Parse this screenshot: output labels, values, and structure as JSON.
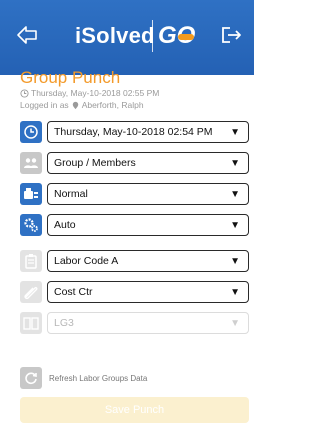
{
  "header": {
    "brand": "iSolved",
    "brand_go": "GO",
    "back_icon": "back-arrow-icon",
    "logout_icon": "logout-icon",
    "bg_color": "#2f71c4",
    "accent": "#f39a1c"
  },
  "page": {
    "title": "Group Punch",
    "current_time": "Thursday, May-10-2018 02:55 PM",
    "logged_in_prefix": "Logged in as",
    "user_name": "Aberforth, Ralph"
  },
  "fields": [
    {
      "icon": "clock-icon",
      "value": "Thursday, May-10-2018 02:54 PM",
      "enabled": true
    },
    {
      "icon": "group-members-icon",
      "value": "Group / Members",
      "enabled": true
    },
    {
      "icon": "punch-type-icon",
      "value": "Normal",
      "enabled": true
    },
    {
      "icon": "gears-icon",
      "value": "Auto",
      "enabled": true
    },
    {
      "icon": "labor-code-icon",
      "value": "Labor Code A",
      "enabled": true
    },
    {
      "icon": "cost-center-icon",
      "value": "Cost Ctr",
      "enabled": true
    },
    {
      "icon": "labor-group-icon",
      "value": "LG3",
      "enabled": false
    }
  ],
  "actions": {
    "refresh_label": "Refresh Labor Groups Data",
    "save_label": "Save Punch"
  }
}
